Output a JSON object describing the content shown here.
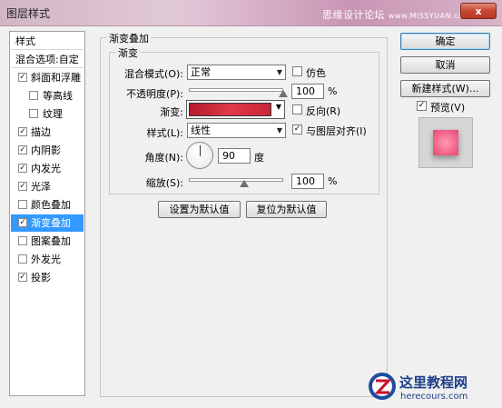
{
  "window": {
    "title": "图层样式",
    "watermark_cn": "思缘设计论坛",
    "watermark_url": "www.MISSYUAN.com",
    "close_label": "x"
  },
  "sidebar": {
    "header": "样式",
    "blend_options": "混合选项:自定",
    "items": [
      {
        "label": "斜面和浮雕",
        "checked": true
      },
      {
        "label": "等高线",
        "checked": false,
        "sub": true
      },
      {
        "label": "纹理",
        "checked": false,
        "sub": true
      },
      {
        "label": "描边",
        "checked": true
      },
      {
        "label": "内阴影",
        "checked": true
      },
      {
        "label": "内发光",
        "checked": true
      },
      {
        "label": "光泽",
        "checked": true
      },
      {
        "label": "颜色叠加",
        "checked": false
      },
      {
        "label": "渐变叠加",
        "checked": true,
        "selected": true
      },
      {
        "label": "图案叠加",
        "checked": false
      },
      {
        "label": "外发光",
        "checked": false
      },
      {
        "label": "投影",
        "checked": true
      }
    ]
  },
  "panel": {
    "outer_title": "渐变叠加",
    "inner_title": "渐变",
    "blend_mode_label": "混合模式(O):",
    "blend_mode_value": "正常",
    "dither_label": "仿色",
    "dither_checked": false,
    "opacity_label": "不透明度(P):",
    "opacity_value": "100",
    "opacity_unit": "%",
    "gradient_label": "渐变:",
    "reverse_label": "反向(R)",
    "reverse_checked": false,
    "style_label": "样式(L):",
    "style_value": "线性",
    "align_label": "与图层对齐(I)",
    "align_checked": true,
    "angle_label": "角度(N):",
    "angle_value": "90",
    "angle_unit": "度",
    "scale_label": "缩放(S):",
    "scale_value": "100",
    "scale_unit": "%",
    "set_default": "设置为默认值",
    "reset_default": "复位为默认值"
  },
  "right": {
    "ok": "确定",
    "cancel": "取消",
    "new_style": "新建样式(W)...",
    "preview_label": "预览(V)",
    "preview_checked": true
  },
  "logo": {
    "text": "这里教程网",
    "url": "herecours.com"
  },
  "checkmark": "✓"
}
